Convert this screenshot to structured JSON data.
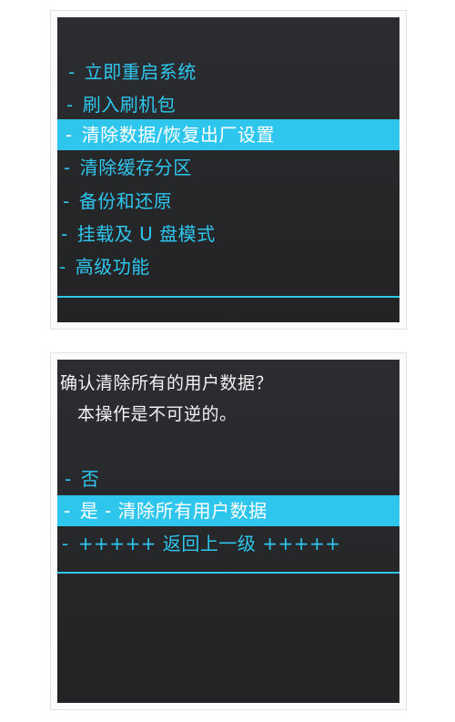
{
  "panel1": {
    "menu": [
      {
        "dash": "-",
        "label": "立即重启系统",
        "selected": false
      },
      {
        "dash": "-",
        "label": "刷入刷机包",
        "selected": false
      },
      {
        "dash": "-",
        "label": "清除数据/恢复出厂设置",
        "selected": true
      },
      {
        "dash": "-",
        "label": "清除缓存分区",
        "selected": false
      },
      {
        "dash": "-",
        "label": "备份和还原",
        "selected": false
      },
      {
        "dash": "-",
        "label": "挂载及 U 盘模式",
        "selected": false
      },
      {
        "dash": "-",
        "label": "高级功能",
        "selected": false
      }
    ]
  },
  "panel2": {
    "prompt_line1": "确认清除所有的用户数据？",
    "prompt_line2": "本操作是不可逆的。",
    "menu": [
      {
        "dash": "-",
        "label": "否",
        "selected": false
      },
      {
        "dash": "-",
        "label": "是  -  清除所有用户数据",
        "selected": true
      },
      {
        "dash": "-",
        "label": "+++++  返回上一级  +++++",
        "selected": false
      }
    ]
  },
  "colors": {
    "accent": "#2fc6ee",
    "screen_bg": "#262729",
    "prompt_text": "#f2f2f2"
  }
}
